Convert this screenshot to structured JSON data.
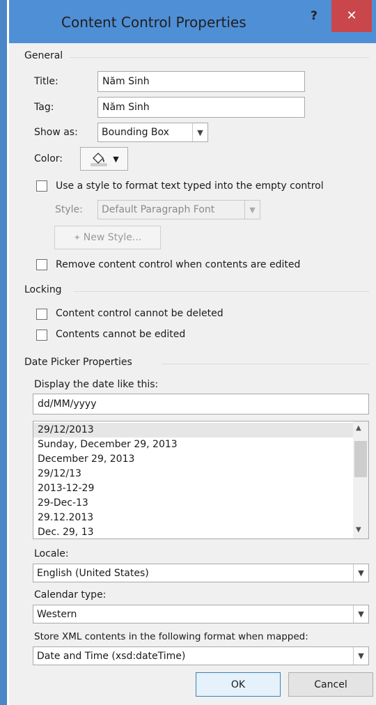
{
  "window": {
    "title": "Content Control Properties",
    "help_label": "?",
    "close_label": "✕"
  },
  "general": {
    "section_label": "General",
    "title_label": "Title:",
    "title_value": "Năm Sinh",
    "tag_label": "Tag:",
    "tag_value": "Năm Sinh",
    "show_as_label": "Show as:",
    "show_as_value": "Bounding Box",
    "color_label": "Color:",
    "use_style_label": "Use a style to format text typed into the empty control",
    "style_label": "Style:",
    "style_value": "Default Paragraph Font",
    "new_style_label": "New Style...",
    "remove_label": "Remove content control when contents are edited"
  },
  "locking": {
    "section_label": "Locking",
    "cannot_delete_label": "Content control cannot be deleted",
    "cannot_edit_label": "Contents cannot be edited"
  },
  "date_picker": {
    "section_label": "Date Picker Properties",
    "display_label": "Display the date like this:",
    "format_value": "dd/MM/yyyy",
    "formats": [
      "29/12/2013",
      "Sunday, December 29, 2013",
      "December 29, 2013",
      "29/12/13",
      "2013-12-29",
      "29-Dec-13",
      "29.12.2013",
      "Dec. 29, 13"
    ],
    "locale_label": "Locale:",
    "locale_value": "English (United States)",
    "calendar_label": "Calendar type:",
    "calendar_value": "Western",
    "store_label": "Store XML contents in the following format when mapped:",
    "store_value": "Date and Time (xsd:dateTime)"
  },
  "buttons": {
    "ok": "OK",
    "cancel": "Cancel"
  }
}
